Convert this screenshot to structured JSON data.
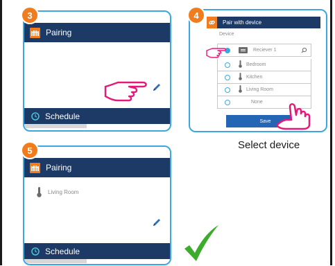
{
  "steps": {
    "s3": {
      "number": "3",
      "header_title": "Pairing",
      "footer_title": "Schedule"
    },
    "s4": {
      "number": "4",
      "header_title": "Pair with device",
      "section_label": "Device",
      "receiver_label": "Reciever 1",
      "rooms": [
        "Bedroom",
        "Kitchen",
        "Living Room"
      ],
      "none_label": "None",
      "save_label": "Save",
      "caption": "Select device"
    },
    "s5": {
      "number": "5",
      "header_title": "Pairing",
      "room": "Living Room",
      "footer_title": "Schedule"
    }
  },
  "colors": {
    "panel_border": "#3aa7e0",
    "navy": "#1d3a66",
    "orange": "#f07c1d",
    "save_button": "#2566b4",
    "check": "#3dac2d"
  },
  "icons": [
    "radiator-icon",
    "schedule-clock-icon",
    "pencil-icon",
    "pointing-hand-icon",
    "thermometer-icon",
    "search-icon",
    "link-icon",
    "checkmark-icon",
    "receiver-icon"
  ]
}
